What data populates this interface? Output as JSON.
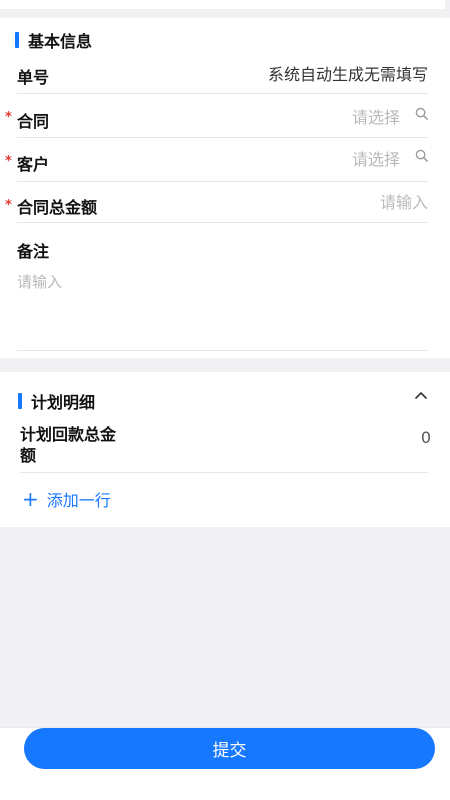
{
  "basic_info": {
    "section_title": "基本信息",
    "fields": {
      "order_no": {
        "label": "单号",
        "value": "系统自动生成无需填写"
      },
      "contract": {
        "label": "合同",
        "placeholder": "请选择",
        "required_mark": "*"
      },
      "customer": {
        "label": "客户",
        "placeholder": "请选择",
        "required_mark": "*"
      },
      "contract_total": {
        "label": "合同总金额",
        "placeholder": "请输入",
        "required_mark": "*"
      },
      "remark": {
        "label": "备注",
        "placeholder": "请输入"
      }
    }
  },
  "plan_detail": {
    "section_title": "计划明细",
    "total_label_line1": "计划回款总金",
    "total_label_line2": "额",
    "total_value": "0",
    "add_row_plus": "+",
    "add_row_label": "添加一行"
  },
  "footer": {
    "submit_label": "提交"
  },
  "colors": {
    "accent": "#1677ff",
    "required": "#e53935",
    "placeholder": "#b9b9bd"
  },
  "icons": {
    "search": "search-icon",
    "collapse": "chevron-up-icon"
  }
}
